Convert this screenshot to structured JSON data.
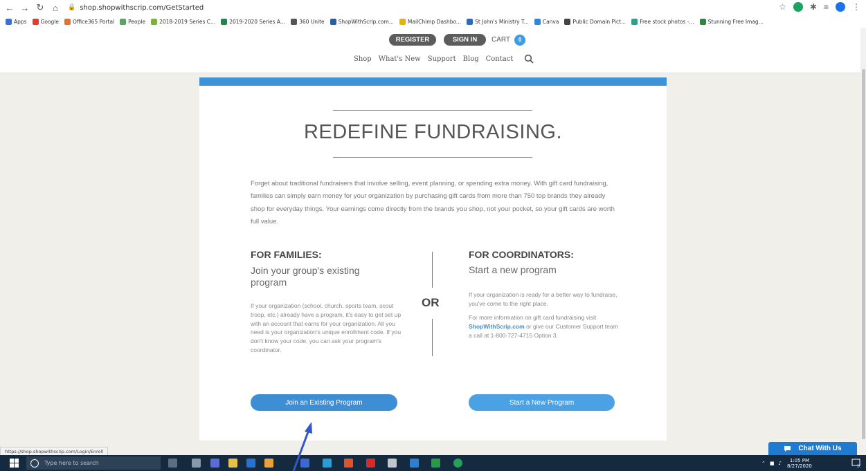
{
  "browser": {
    "url": "shop.shopwithscrip.com/GetStarted",
    "bookmarks": [
      "Apps",
      "Google",
      "Office365 Portal",
      "People",
      "2018-2019 Series C...",
      "2019-2020 Series A...",
      "360 Unite",
      "ShopWithScrip.com...",
      "MailChimp Dashbo...",
      "St John's Ministry T...",
      "Canva",
      "Public Domain Pict...",
      "Free stock photos -...",
      "Stunning Free Imag..."
    ],
    "bookmark_colors": [
      "#3b6fd8",
      "#e33b2e",
      "#e8702a",
      "#57a85b",
      "#7bb23a",
      "#1a8a4c",
      "#555555",
      "#1f5fb3",
      "#e6b400",
      "#2a6cc0",
      "#2f86d9",
      "#444444",
      "#2aa18b",
      "#2a8b3a"
    ]
  },
  "header": {
    "register_label": "REGISTER",
    "signin_label": "SIGN IN",
    "cart_label": "CART",
    "cart_count": "0",
    "nav": [
      "Shop",
      "What's New",
      "Support",
      "Blog",
      "Contact"
    ]
  },
  "content": {
    "headline": "REDEFINE FUNDRAISING.",
    "intro": "Forget about traditional fundraisers that involve selling, event planning, or spending extra money. With gift card fundraising, families can simply earn money for your organization by purchasing gift cards from more than 750 top brands they already shop for everyday things. Your earnings come directly from the brands you shop, not your pocket, so your gift cards are worth full value.",
    "families": {
      "title": "FOR FAMILIES:",
      "subtitle": "Join your group's existing program",
      "body": "If your organization (school, church, sports team, scout troop, etc.) already have a program, it's easy to get set up with an account that earns for your organization. All you need is your organization's unique enrollment code. If you don't know your code, you can ask your program's coordinator.",
      "button": "Join an Existing Program"
    },
    "or_label": "OR",
    "coordinators": {
      "title": "FOR COORDINATORS:",
      "subtitle": "Start a new program",
      "body1": "If your organization is ready for a better way to fundraise, you've come to the right place.",
      "body2_pre": "For more information on gift card fundraising visit",
      "body2_link": "ShopWithScrip.com",
      "body2_post": "or give our Customer Support team a call at 1-800-727-4715 Option 3.",
      "button": "Start a New Program"
    }
  },
  "status_url": "https://shop.shopwithscrip.com/Login/Enroll",
  "chat_label": "Chat With Us",
  "taskbar": {
    "search_placeholder": "Type here to search",
    "time": "1:05 PM",
    "date": "8/27/2020",
    "notification_count": "20"
  },
  "colors": {
    "accent": "#3e8ed6",
    "header_button": "#5c5c5c",
    "taskbar": "#152a3f",
    "annotation_arrow": "#3556c9"
  }
}
